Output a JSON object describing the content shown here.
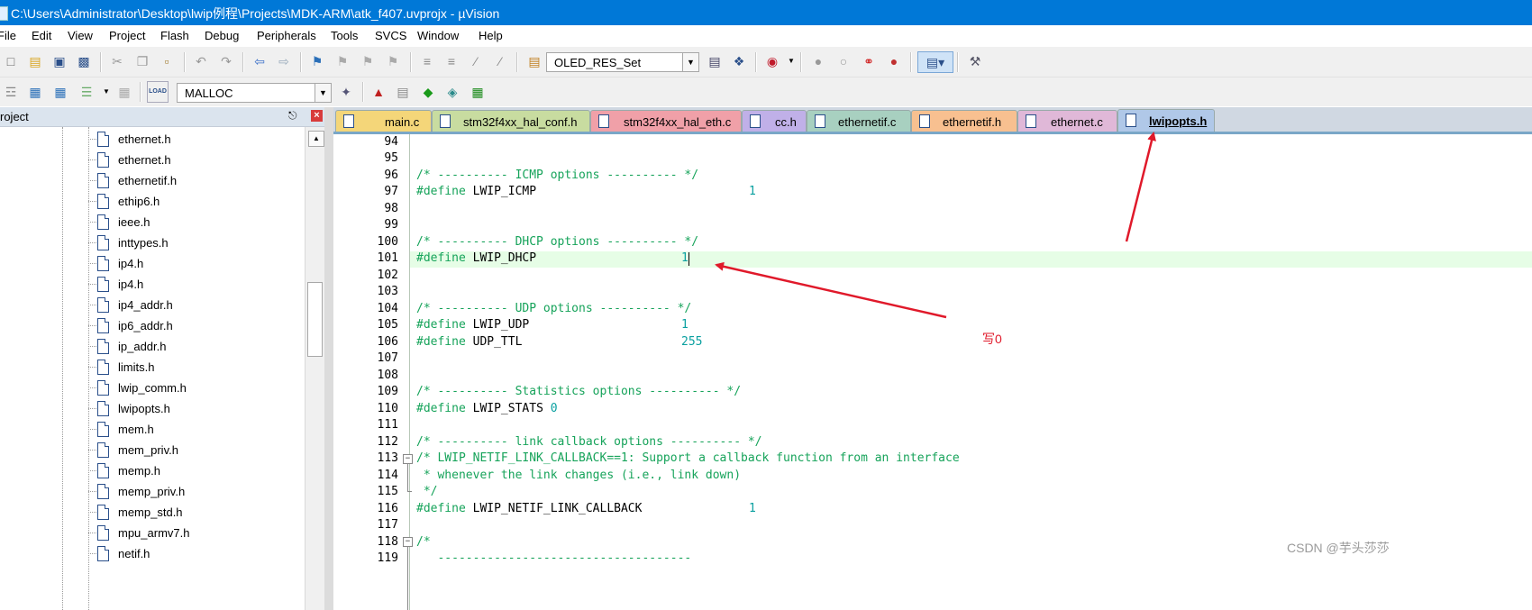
{
  "window": {
    "title": "C:\\Users\\Administrator\\Desktop\\lwip例程\\Projects\\MDK-ARM\\atk_f407.uvprojx - µVision"
  },
  "menu": [
    "File",
    "Edit",
    "View",
    "Project",
    "Flash",
    "Debug",
    "Peripherals",
    "Tools",
    "SVCS",
    "Window",
    "Help"
  ],
  "toolbar1": {
    "target_combo": "OLED_RES_Set"
  },
  "toolbar2": {
    "target_select": "MALLOC",
    "load_label": "LOAD"
  },
  "project_panel": {
    "title": "roject",
    "files": [
      "ethernet.h",
      "ethernet.h",
      "ethernetif.h",
      "ethip6.h",
      "ieee.h",
      "inttypes.h",
      "ip4.h",
      "ip4.h",
      "ip4_addr.h",
      "ip6_addr.h",
      "ip_addr.h",
      "limits.h",
      "lwip_comm.h",
      "lwipopts.h",
      "mem.h",
      "mem_priv.h",
      "memp.h",
      "memp_priv.h",
      "memp_std.h",
      "mpu_armv7.h",
      "netif.h"
    ]
  },
  "tabs": [
    {
      "label": "main.c",
      "color": "#f4d679"
    },
    {
      "label": "stm32f4xx_hal_conf.h",
      "color": "#c8dca0"
    },
    {
      "label": "stm32f4xx_hal_eth.c",
      "color": "#f0a0a8"
    },
    {
      "label": "cc.h",
      "color": "#c0b0e8"
    },
    {
      "label": "ethernetif.c",
      "color": "#a8d0c0"
    },
    {
      "label": "ethernetif.h",
      "color": "#f8c090"
    },
    {
      "label": "ethernet.c",
      "color": "#e0b8d8"
    },
    {
      "label": "lwipopts.h",
      "color": "#b0c8e8",
      "active": true
    }
  ],
  "code": {
    "line_numbers": [
      "94",
      "95",
      "96",
      "97",
      "98",
      "99",
      "100",
      "101",
      "102",
      "103",
      "104",
      "105",
      "106",
      "107",
      "108",
      "109",
      "110",
      "111",
      "112",
      "113",
      "114",
      "115",
      "116",
      "117",
      "118",
      "119"
    ],
    "lines": {
      "l96": "/* ---------- ICMP options ---------- */",
      "l97_define": "#define",
      "l97_name": " LWIP_ICMP",
      "l97_val": "1",
      "l100": "/* ---------- DHCP options ---------- */",
      "l101_define": "#define",
      "l101_name": " LWIP_DHCP",
      "l101_val": "1",
      "l104": "/* ---------- UDP options ---------- */",
      "l105_define": "#define",
      "l105_name": " LWIP_UDP",
      "l105_val": "1",
      "l106_define": "#define",
      "l106_name": " UDP_TTL",
      "l106_val": "255",
      "l109": "/* ---------- Statistics options ---------- */",
      "l110_define": "#define",
      "l110_name": " LWIP_STATS",
      "l110_val": "0",
      "l112": "/* ---------- link callback options ---------- */",
      "l113": "/* LWIP_NETIF_LINK_CALLBACK==1: Support a callback function from an interface",
      "l114": " * whenever the link changes (i.e., link down)",
      "l115": " */",
      "l116_define": "#define",
      "l116_name": " LWIP_NETIF_LINK_CALLBACK",
      "l116_val": "1",
      "l118": "/*",
      "l119": "   ------------------------------------"
    }
  },
  "annotation": {
    "note": "写0",
    "color": "#e0192a"
  },
  "watermark": "CSDN @芋头莎莎"
}
